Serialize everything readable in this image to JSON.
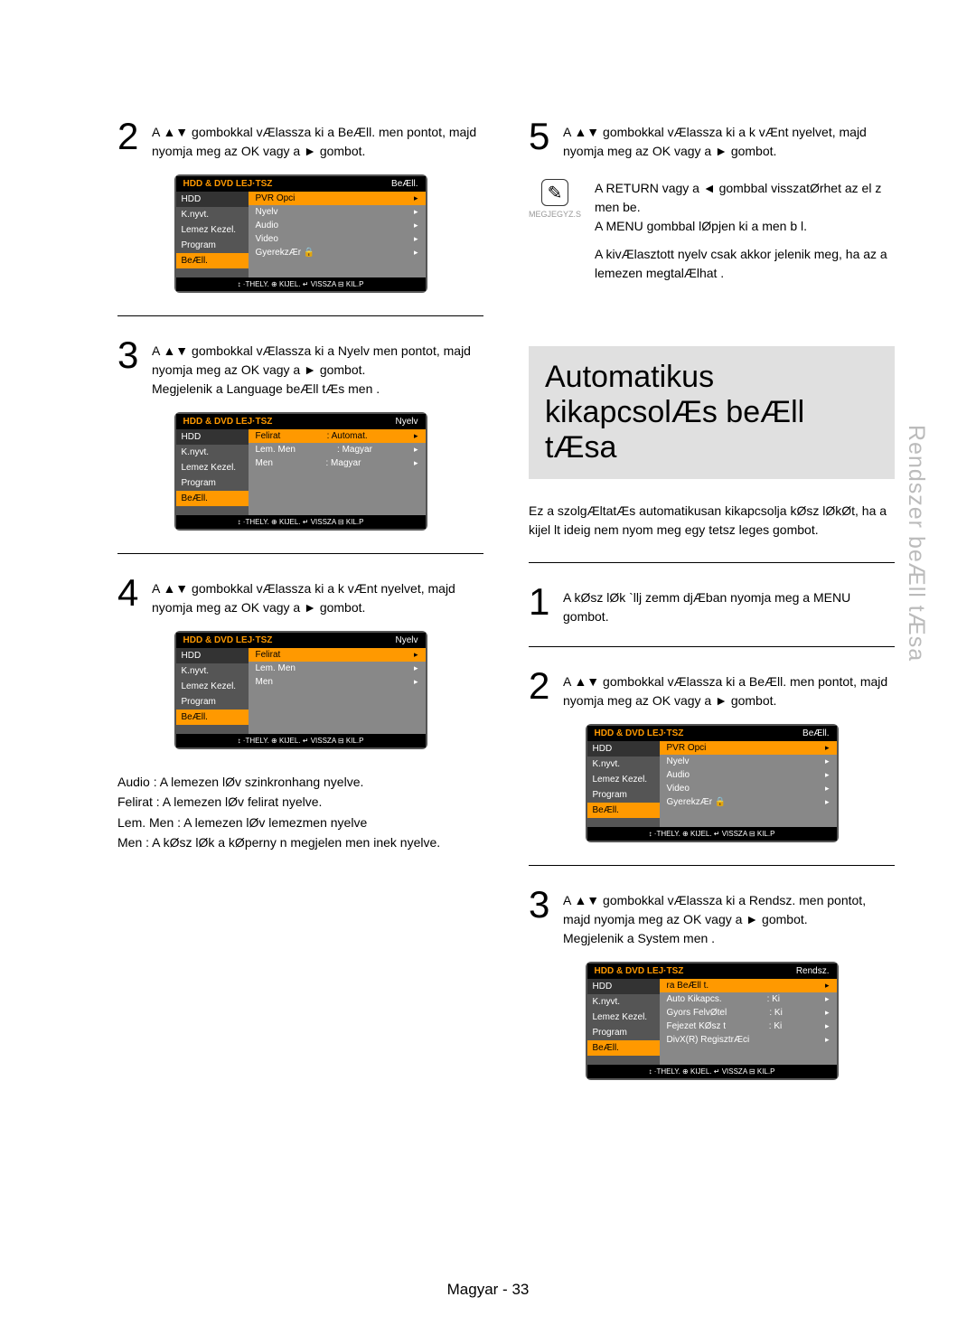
{
  "sidetab": "Rendszer beÆll tÆsa",
  "page_footer": "Magyar - 33",
  "osd_header_left": "HDD & DVD LEJ·TSZ",
  "osd_bottom": "↕ ·THELY.   ⊕ KIJEL.   ↵ VISSZA   ⊟ KIL.P",
  "note": {
    "label": "MEGJEGYZ.S",
    "line1": "A RETURN vagy a ◄ gombbal visszatØrhet az el z  men be.",
    "line2": "A MENU gombbal lØpjen ki a men b l.",
    "line3": "A kivÆlasztott nyelv csak akkor jelenik meg, ha az a lemezen megtalÆlhat ."
  },
  "heading": {
    "line1": "Automatikus",
    "line2": "kikapcsolÆs beÆll tÆsa"
  },
  "heading_desc": "Ez a szolgÆltatÆs automatikusan kikapcsolja kØsz lØkØt, ha a kijel lt ideig nem nyom meg egy tetsz leges gombot.",
  "left": {
    "step2": {
      "num": "2",
      "text": "A ▲▼ gombokkal vÆlassza ki a BeÆll. men pontot, majd nyomja meg az OK vagy a ► gombot."
    },
    "step3": {
      "num": "3",
      "text": "A ▲▼ gombokkal vÆlassza ki a Nyelv men pontot, majd nyomja meg az OK vagy a ► gombot.",
      "text2": "Megjelenik a Language beÆll tÆs men ."
    },
    "step4": {
      "num": "4",
      "text": "A ▲▼ gombokkal vÆlassza ki a k vÆnt nyelvet, majd nyomja meg az OK vagy a ► gombot."
    },
    "defs": {
      "audio": "Audio : A lemezen lØv  szinkronhang nyelve.",
      "felirat": "Felirat : A lemezen lØv  felirat nyelve.",
      "lemmen": "Lem. Men  : A lemezen lØv  lemezmen  nyelve",
      "men": "Men  : A kØsz lØk a kØperny n megjelen  men inek nyelve."
    }
  },
  "right": {
    "step5": {
      "num": "5",
      "text": "A ▲▼ gombokkal vÆlassza ki a k vÆnt nyelvet, majd nyomja meg az OK vagy a ► gombot."
    },
    "step1": {
      "num": "1",
      "text": "A kØsz lØk `llj  zemm djÆban nyomja meg a MENU gombot."
    },
    "stepB2": {
      "num": "2",
      "text": "A ▲▼ gombokkal vÆlassza ki a BeÆll. men pontot, majd nyomja meg az OK vagy a ► gombot."
    },
    "stepB3": {
      "num": "3",
      "text": "A ▲▼ gombokkal vÆlassza ki a Rendsz. men pontot, majd nyomja meg az OK vagy a ► gombot.",
      "text2": "Megjelenik a System men ."
    }
  },
  "osd1": {
    "title_right": "BeÆll.",
    "left": [
      "HDD",
      "K.nyvt.",
      "Lemez Kezel.",
      "Program",
      "BeÆll."
    ],
    "active": 4,
    "rows": [
      {
        "l": "PVR Opci",
        "r": "",
        "h": true
      },
      {
        "l": "Nyelv",
        "r": ""
      },
      {
        "l": "Audio",
        "r": ""
      },
      {
        "l": "Video",
        "r": ""
      },
      {
        "l": "GyerekzÆr 🔒",
        "r": ""
      }
    ]
  },
  "osd2": {
    "title_right": "Nyelv",
    "left": [
      "HDD",
      "K.nyvt.",
      "Lemez Kezel.",
      "Program",
      "BeÆll."
    ],
    "active": 4,
    "rows": [
      {
        "l": "Felirat",
        "r": ": Automat.",
        "h": true
      },
      {
        "l": "Lem. Men",
        "r": ": Magyar"
      },
      {
        "l": "Men",
        "r": ": Magyar"
      }
    ]
  },
  "osd3": {
    "title_right": "Nyelv",
    "left": [
      "HDD",
      "K.nyvt.",
      "Lemez Kezel.",
      "Program",
      "BeÆll."
    ],
    "active": 4,
    "rows": [
      {
        "l": "Felirat",
        "r": "",
        "h": true
      },
      {
        "l": "Lem. Men",
        "r": ""
      },
      {
        "l": "Men",
        "r": ""
      }
    ]
  },
  "osd4": {
    "title_right": "BeÆll.",
    "left": [
      "HDD",
      "K.nyvt.",
      "Lemez Kezel.",
      "Program",
      "BeÆll."
    ],
    "active": 4,
    "rows": [
      {
        "l": "PVR Opci",
        "r": "",
        "h": true
      },
      {
        "l": "Nyelv",
        "r": ""
      },
      {
        "l": "Audio",
        "r": ""
      },
      {
        "l": "Video",
        "r": ""
      },
      {
        "l": "GyerekzÆr 🔒",
        "r": ""
      }
    ]
  },
  "osd5": {
    "title_right": "Rendsz.",
    "left": [
      "HDD",
      "K.nyvt.",
      "Lemez Kezel.",
      "Program",
      "BeÆll."
    ],
    "active": 4,
    "rows": [
      {
        "l": "ra BeÆll t.",
        "r": "",
        "h": true
      },
      {
        "l": "Auto Kikapcs.",
        "r": ": Ki"
      },
      {
        "l": "Gyors FelvØtel",
        "r": ": Ki"
      },
      {
        "l": "Fejezet KØsz t",
        "r": ": Ki"
      },
      {
        "l": "DivX(R) RegisztrÆci",
        "r": ""
      }
    ]
  }
}
